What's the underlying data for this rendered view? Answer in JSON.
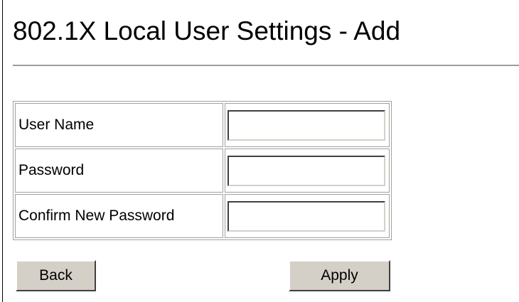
{
  "page": {
    "title": "802.1X Local User Settings - Add"
  },
  "form": {
    "fields": [
      {
        "label": "User Name",
        "value": ""
      },
      {
        "label": "Password",
        "value": ""
      },
      {
        "label": "Confirm New Password",
        "value": ""
      }
    ]
  },
  "buttons": {
    "back_label": "Back",
    "apply_label": "Apply"
  },
  "colors": {
    "button_face": "#d4d0c8",
    "rule": "#9c9c9c",
    "table_border": "#a0a0a0"
  }
}
